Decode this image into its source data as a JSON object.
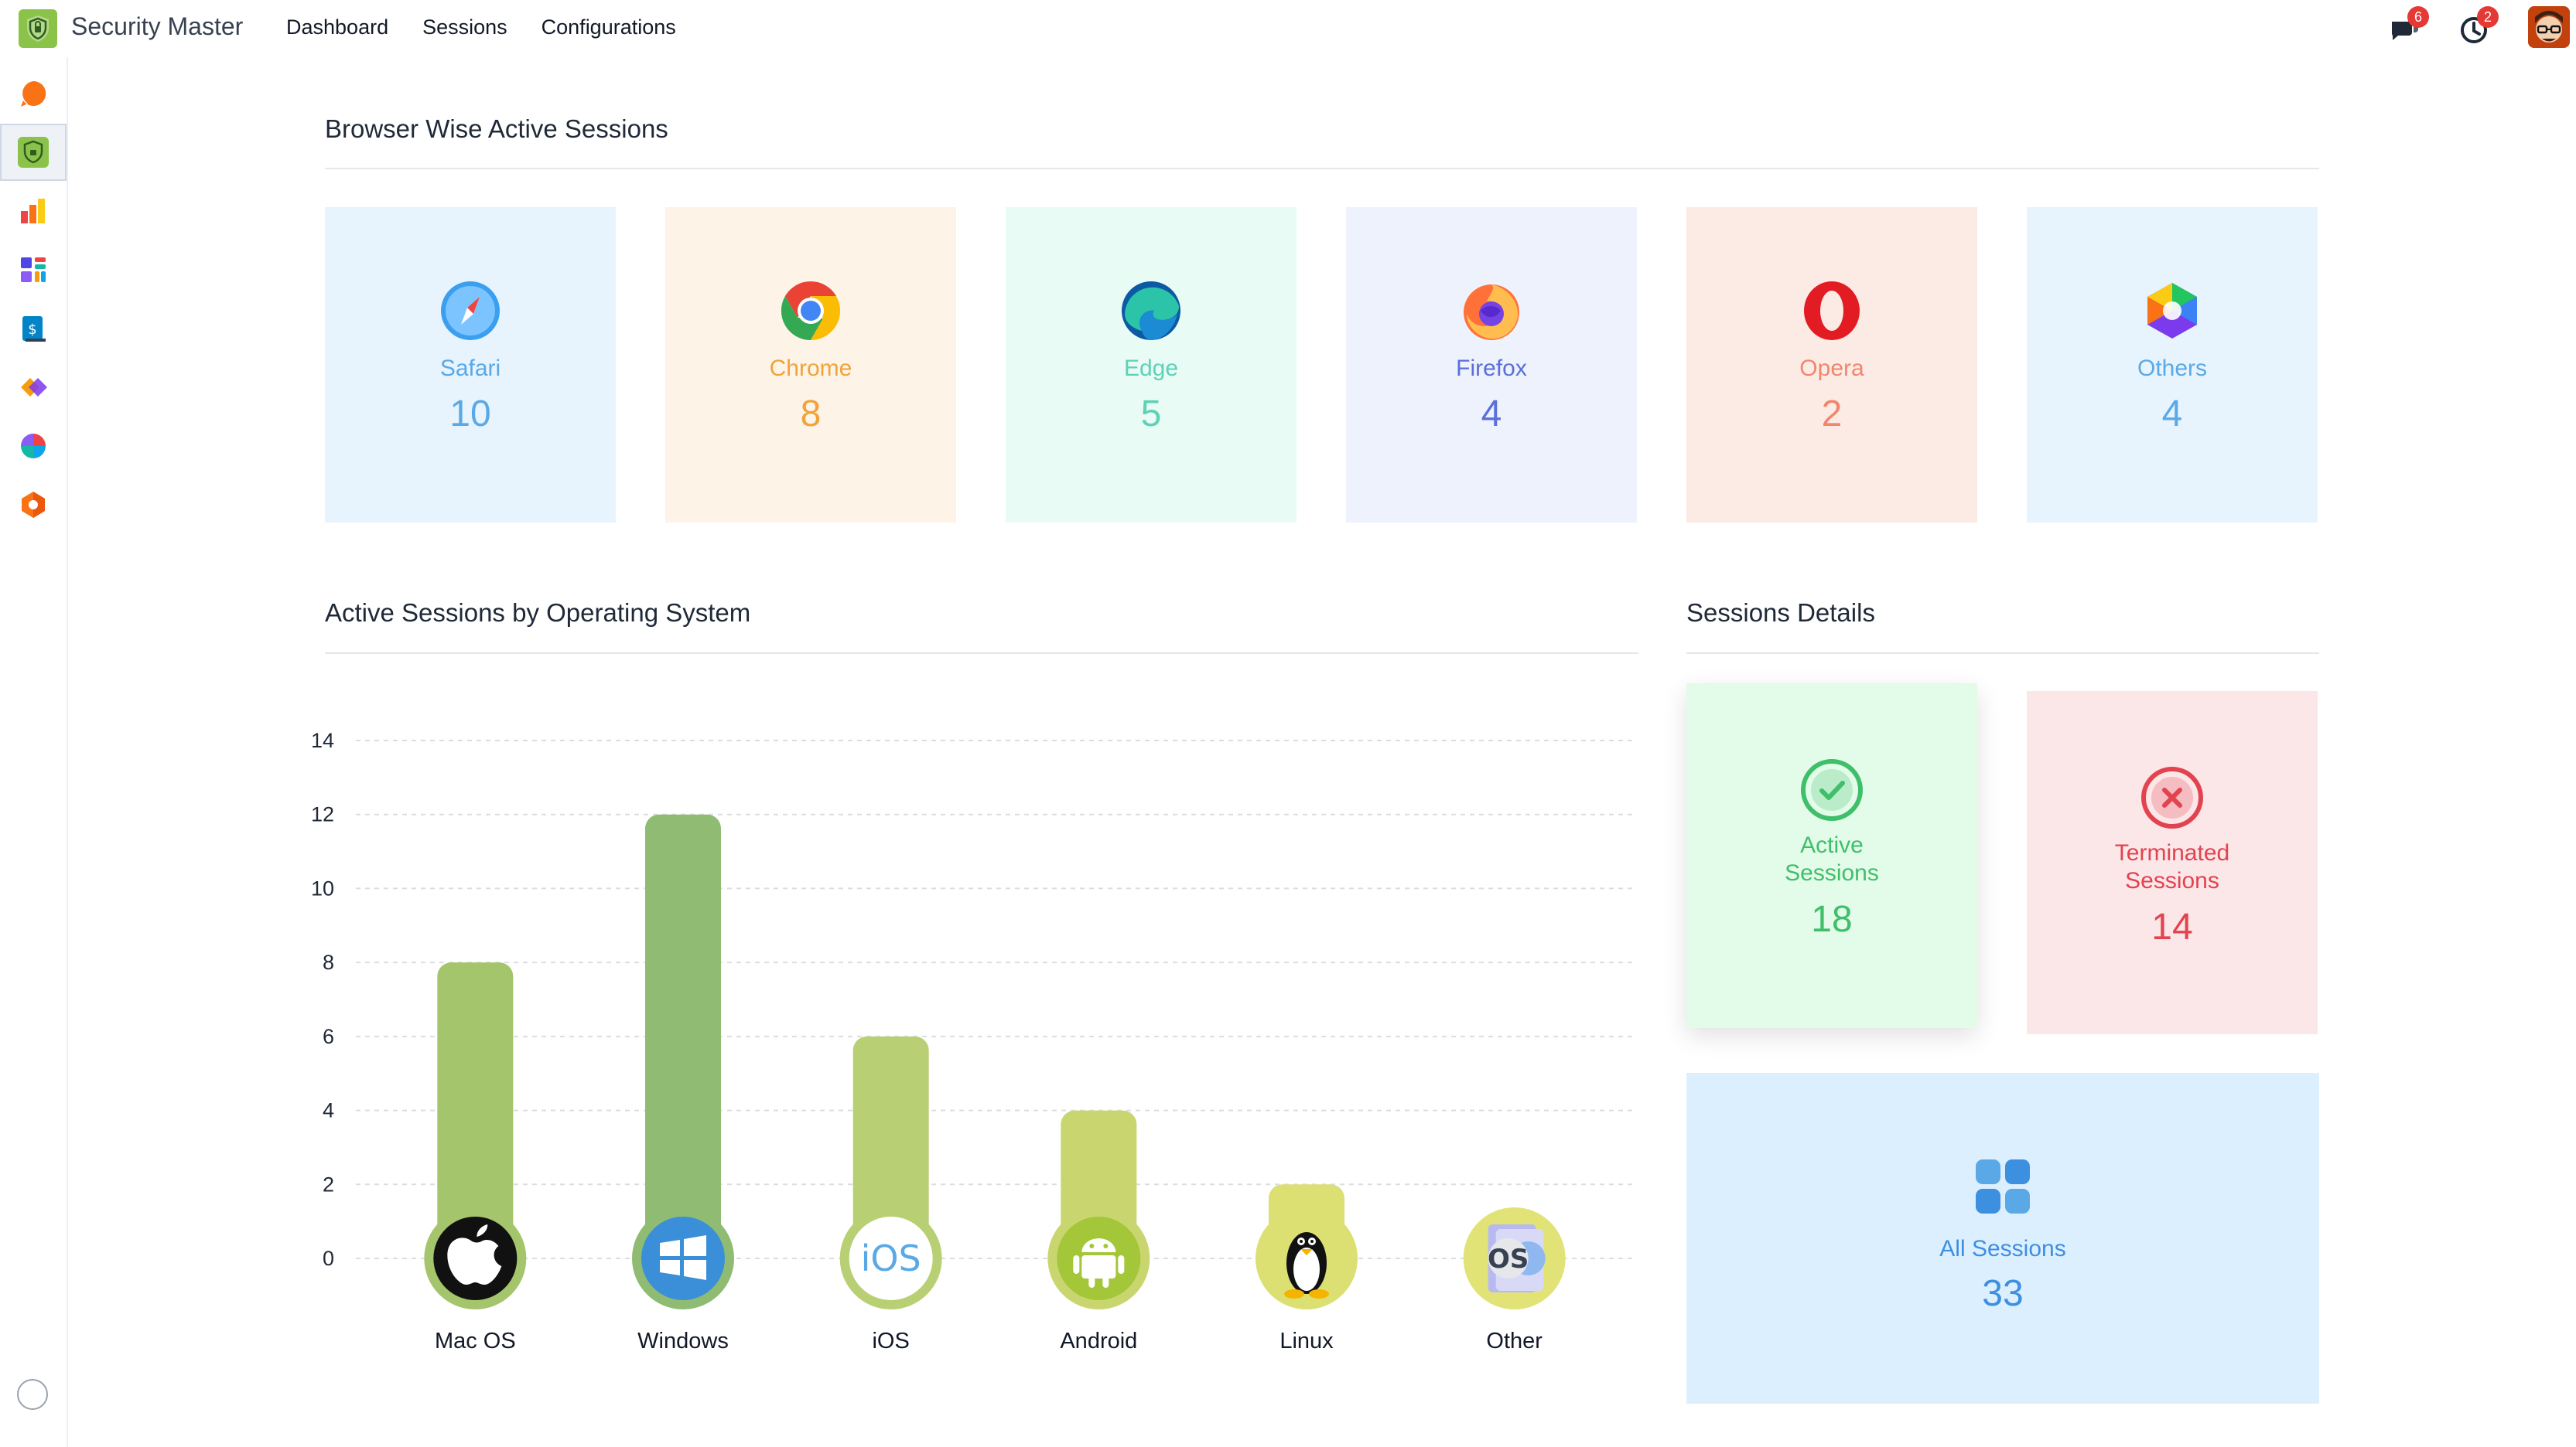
{
  "app": {
    "name": "Security Master"
  },
  "nav": {
    "dashboard": "Dashboard",
    "sessions": "Sessions",
    "configurations": "Configurations"
  },
  "systray": {
    "messages_count": "6",
    "activities_count": "2"
  },
  "browser_section": {
    "title": "Browser Wise Active Sessions"
  },
  "browsers": [
    {
      "name": "Safari",
      "count": "10",
      "bg": "#e7f4fd",
      "color": "#5aa9e6",
      "icon": "safari-icon"
    },
    {
      "name": "Chrome",
      "count": "8",
      "bg": "#fdf3e7",
      "color": "#f0a33a",
      "icon": "chrome-icon"
    },
    {
      "name": "Edge",
      "count": "5",
      "bg": "#e8fbf5",
      "color": "#5ed1b7",
      "icon": "edge-icon"
    },
    {
      "name": "Firefox",
      "count": "4",
      "bg": "#edf2fd",
      "color": "#5a6fd8",
      "icon": "firefox-icon"
    },
    {
      "name": "Opera",
      "count": "2",
      "bg": "#fcebe4",
      "color": "#f0866e",
      "icon": "opera-icon"
    },
    {
      "name": "Others",
      "count": "4",
      "bg": "#e7f4fd",
      "color": "#5aa9e6",
      "icon": "others-browser-icon"
    }
  ],
  "os_section": {
    "title": "Active Sessions by Operating System"
  },
  "details_section": {
    "title": "Sessions Details"
  },
  "chart_data": {
    "type": "bar",
    "categories": [
      "Mac OS",
      "Windows",
      "iOS",
      "Android",
      "Linux",
      "Other"
    ],
    "values": [
      8,
      12,
      6,
      4,
      2,
      0
    ],
    "bar_colors": [
      "#a4c56b",
      "#8fbc72",
      "#b8cf73",
      "#c9d66f",
      "#dcdf72",
      "#e2e376"
    ],
    "icons": [
      "apple-icon",
      "windows-icon",
      "ios-icon",
      "android-icon",
      "linux-icon",
      "other-os-icon"
    ],
    "yticks": [
      0,
      2,
      4,
      6,
      8,
      10,
      12,
      14
    ],
    "ylim": [
      0,
      14
    ],
    "grid": true
  },
  "session_details": {
    "active": {
      "label_line1": "Active",
      "label_line2": "Sessions",
      "value": "18"
    },
    "terminated": {
      "label_line1": "Terminated",
      "label_line2": "Sessions",
      "value": "14"
    },
    "all": {
      "label": "All Sessions",
      "value": "33"
    }
  },
  "colors": {
    "active_bg": "#e3fbe9",
    "active_text": "#3fbf6a",
    "terminated_bg": "#fbe6e8",
    "terminated_text": "#e2434f",
    "all_bg": "#dcefff",
    "all_text": "#3d8fe0"
  }
}
